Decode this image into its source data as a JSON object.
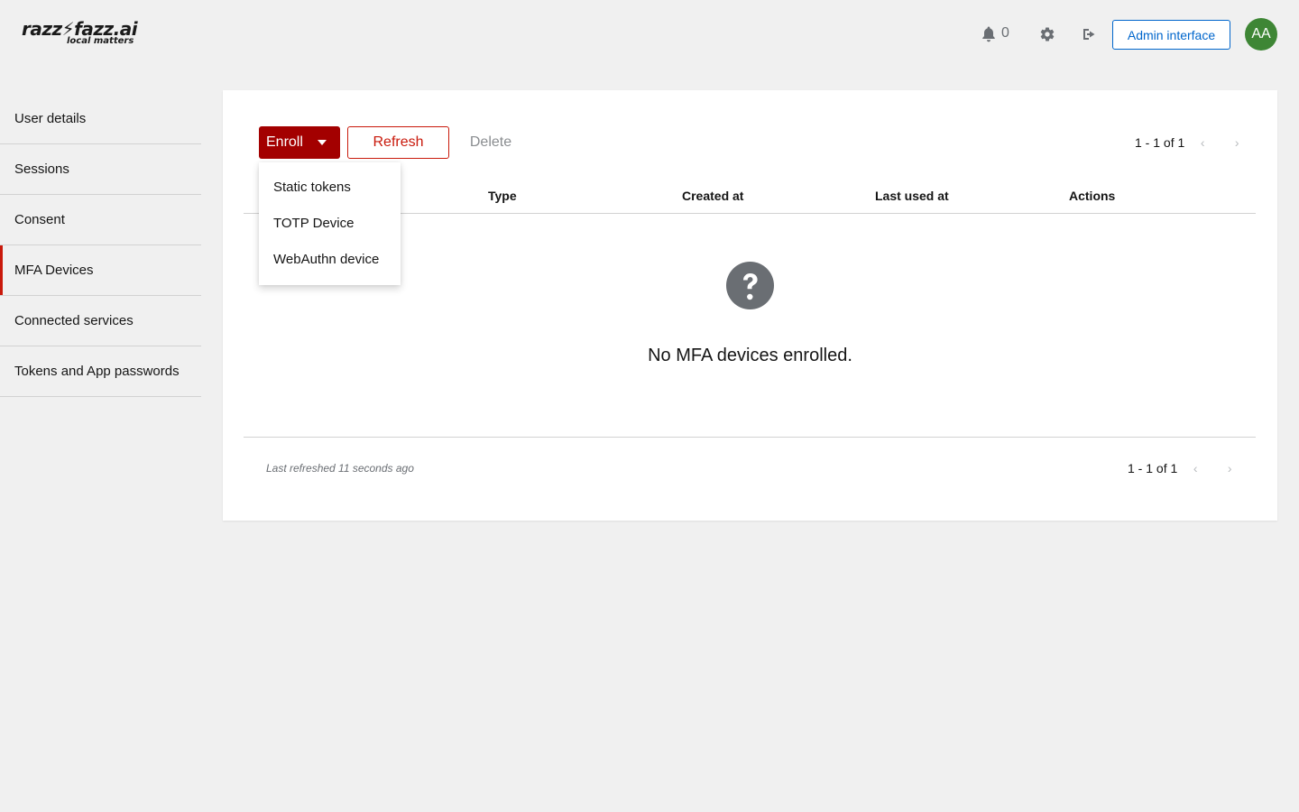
{
  "header": {
    "logo": {
      "main": "razz⚡fazz.ai",
      "sub": "local matters"
    },
    "notifications": {
      "icon": "bell-icon",
      "count": "0"
    },
    "settings_icon": "gear-icon",
    "logout_icon": "logout-icon",
    "admin_button": "Admin interface",
    "avatar_initials": "AA"
  },
  "sidebar": {
    "items": [
      {
        "label": "User details"
      },
      {
        "label": "Sessions"
      },
      {
        "label": "Consent"
      },
      {
        "label": "MFA Devices",
        "active": true
      },
      {
        "label": "Connected services"
      },
      {
        "label": "Tokens and App passwords"
      }
    ]
  },
  "toolbar": {
    "enroll_label": "Enroll",
    "refresh_label": "Refresh",
    "delete_label": "Delete",
    "pagination": "1 - 1 of 1"
  },
  "enroll_menu": {
    "items": [
      "Static tokens",
      "TOTP Device",
      "WebAuthn device"
    ]
  },
  "table": {
    "columns": [
      "Type",
      "Created at",
      "Last used at",
      "Actions"
    ],
    "empty_icon": "question-circle-icon",
    "empty_message": "No MFA devices enrolled."
  },
  "footer": {
    "last_refreshed": "Last refreshed 11 seconds ago",
    "pagination": "1 - 1 of 1"
  },
  "colors": {
    "primary_red": "#a30000",
    "accent_red": "#c9190b",
    "link_blue": "#0066cc",
    "avatar_green": "#3e8635"
  }
}
